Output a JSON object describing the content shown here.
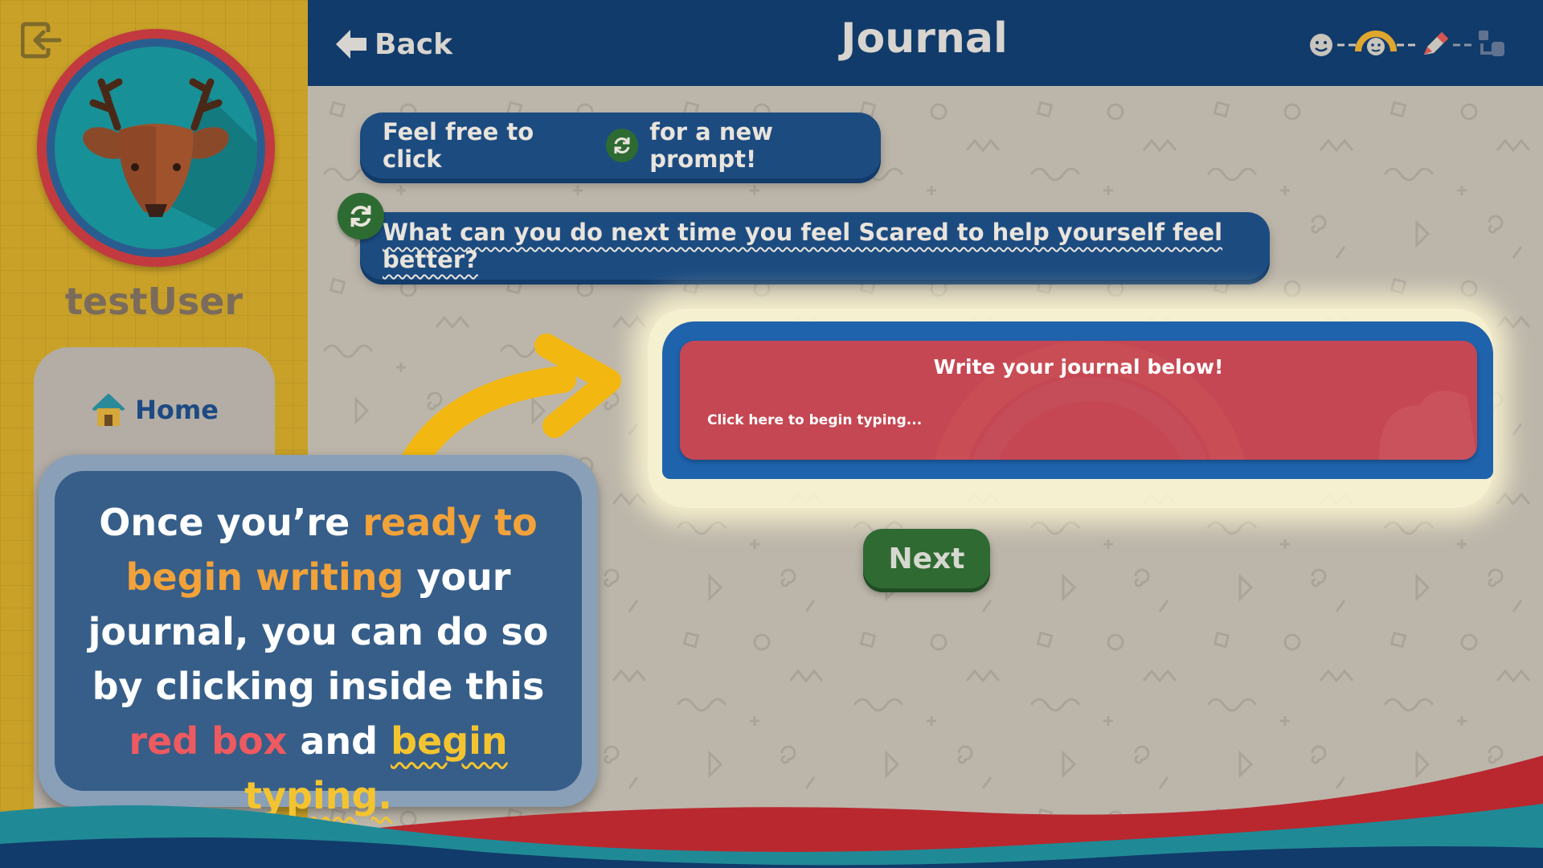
{
  "sidebar": {
    "logout_icon": "logout-icon",
    "avatar": "deer-avatar",
    "username": "testUser",
    "nav": [
      {
        "label": "Home",
        "icon": "house-icon"
      }
    ]
  },
  "header": {
    "back_label": "Back",
    "title": "Journal",
    "steps": [
      "smiley-icon",
      "rainbow-icon",
      "pencil-icon",
      "puzzle-icon"
    ]
  },
  "main": {
    "hint": {
      "before": "Feel free to click",
      "after": "for a new prompt!"
    },
    "prompt": "What can you do next time you feel Scared to help yourself feel better?",
    "journal": {
      "heading": "Write your journal below!",
      "placeholder": "Click here to begin typing..."
    },
    "next_label": "Next"
  },
  "tutorial": {
    "t1": "Once you’re ",
    "t2": "ready to begin writing",
    "t3": " your journal, you can do so by clicking inside this ",
    "t4": "red box",
    "t5": " and ",
    "t6": "begin typing."
  },
  "colors": {
    "header": "#113b6a",
    "sidebar": "#c9a128",
    "bubble": "#1c4b80",
    "journal_box": "#c54753",
    "next_button": "#2f6a33",
    "tip_panel": "#365e89"
  }
}
